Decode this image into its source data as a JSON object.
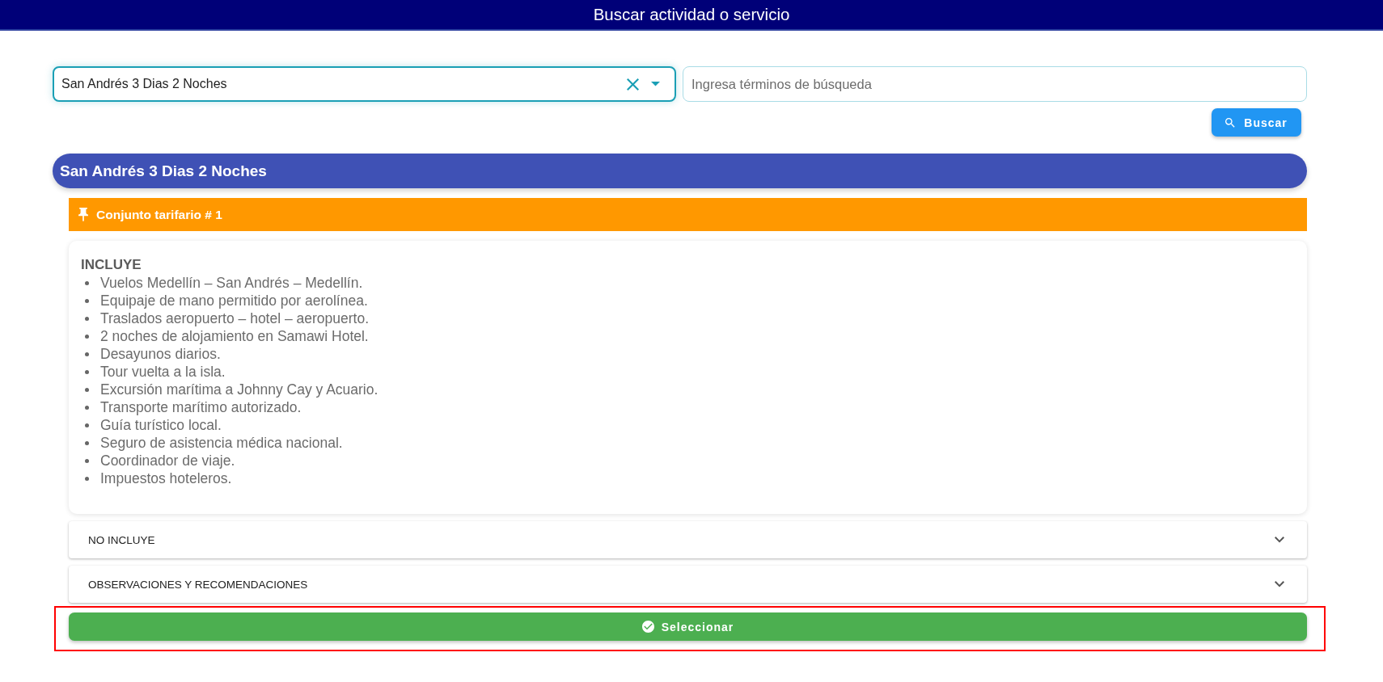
{
  "header": {
    "title": "Buscar actividad o servicio"
  },
  "search": {
    "select_value": "San Andrés 3 Dias 2 Noches",
    "focused": true,
    "placeholder": "Ingresa términos de búsqueda",
    "button": "Buscar"
  },
  "package": {
    "title": "San Andrés 3 Dias 2 Noches",
    "rate_set": "Conjunto tarifario # 1",
    "includes": {
      "heading": "INCLUYE",
      "items": [
        "Vuelos Medellín – San Andrés – Medellín.",
        "Equipaje de mano permitido por aerolínea.",
        "Traslados aeropuerto – hotel – aeropuerto.",
        "2 noches de alojamiento en Samawi Hotel.",
        "Desayunos diarios.",
        "Tour vuelta a la isla.",
        "Excursión marítima a Johnny Cay y Acuario.",
        "Transporte marítimo autorizado.",
        "Guía turístico local.",
        "Seguro de asistencia médica nacional.",
        "Coordinador de viaje.",
        "Impuestos hoteleros."
      ]
    },
    "sections": [
      {
        "label": "NO INCLUYE",
        "expanded": false
      },
      {
        "label": "OBSERVACIONES Y RECOMENDACIONES",
        "expanded": false
      }
    ],
    "select_button": {
      "label": "Seleccionar",
      "highlighted": true
    }
  }
}
